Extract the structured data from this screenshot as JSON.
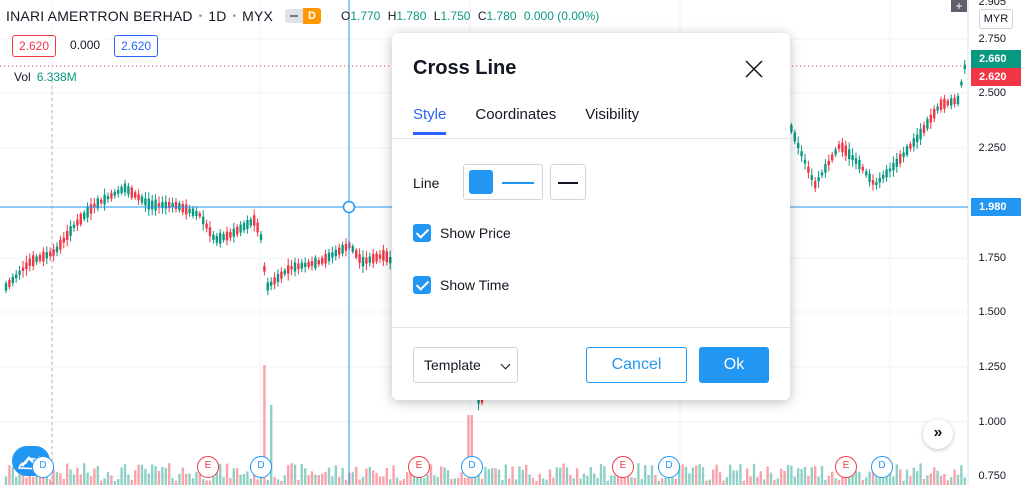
{
  "header": {
    "symbol": "INARI AMERTRON BERHAD",
    "interval": "1D",
    "exchange": "MYX",
    "delay_badge": "D",
    "ohlc": {
      "o_label": "O",
      "o": "1.770",
      "h_label": "H",
      "h": "1.780",
      "l_label": "L",
      "l": "1.750",
      "c_label": "C",
      "c": "1.780",
      "change": "0.000 (0.00%)"
    }
  },
  "trade": {
    "sell_price": "2.620",
    "spread": "0.000",
    "buy_price": "2.620"
  },
  "volume": {
    "label": "Vol",
    "value": "6.338M"
  },
  "price_axis": {
    "currency": "MYR",
    "top_partial": "2.905",
    "ticks": [
      "2.750",
      "2.500",
      "2.250",
      "1.750",
      "1.500",
      "1.250",
      "1.000",
      "0.750"
    ],
    "tags": {
      "high_tag": "2.660",
      "last_tag": "2.620",
      "crosshair_tag": "1.980"
    }
  },
  "colors": {
    "up": "#089981",
    "down": "#f23645",
    "accent": "#2196f3",
    "crosshair": "#2196f3",
    "delay": "#ff9800"
  },
  "events": [
    "D",
    "E",
    "D",
    "E",
    "D",
    "E",
    "D",
    "E",
    "D"
  ],
  "icons": {
    "logo": "tradingview-cloud-icon",
    "scroll": "double-chevron-right-icon",
    "plus": "plus-icon",
    "close": "close-icon"
  },
  "dialog": {
    "title": "Cross Line",
    "tabs": [
      {
        "label": "Style",
        "active": true
      },
      {
        "label": "Coordinates",
        "active": false
      },
      {
        "label": "Visibility",
        "active": false
      }
    ],
    "line_label": "Line",
    "show_price_label": "Show Price",
    "show_price_checked": true,
    "show_time_label": "Show Time",
    "show_time_checked": true,
    "template_label": "Template",
    "cancel_label": "Cancel",
    "ok_label": "Ok"
  }
}
